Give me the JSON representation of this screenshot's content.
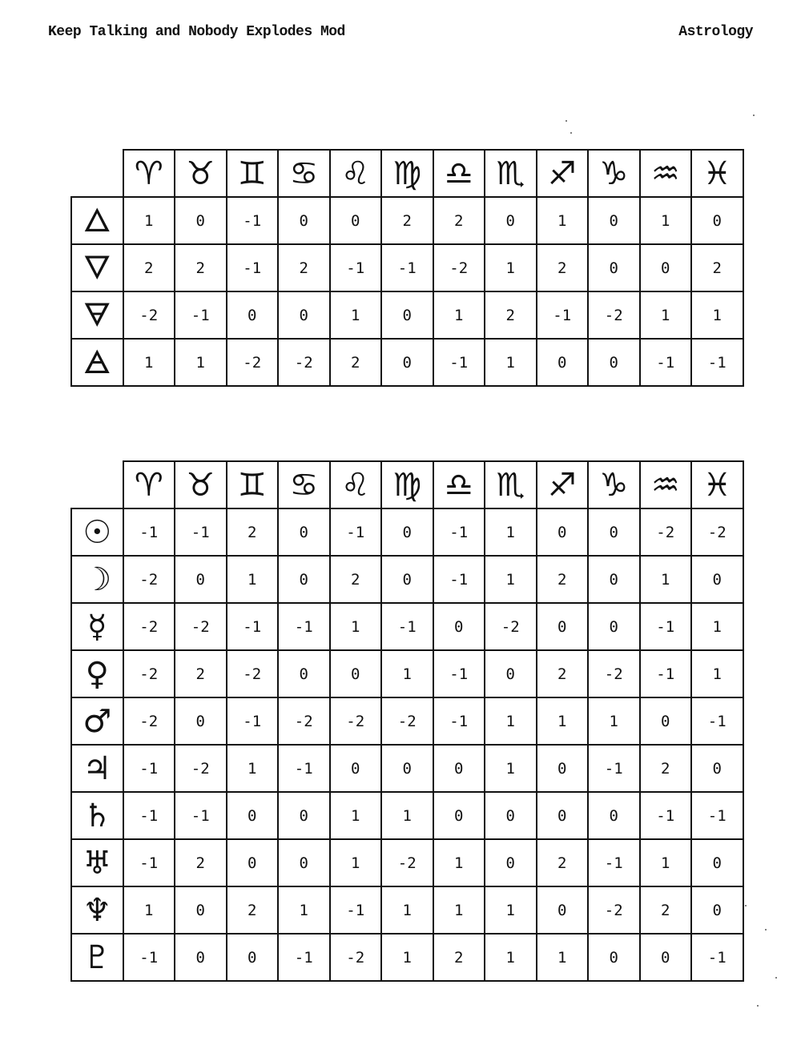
{
  "header": {
    "left": "Keep Talking and Nobody Explodes Mod",
    "right": "Astrology"
  },
  "zodiac": [
    {
      "glyph": "♈",
      "icon": "aries-icon"
    },
    {
      "glyph": "♉",
      "icon": "taurus-icon"
    },
    {
      "glyph": "♊",
      "icon": "gemini-icon"
    },
    {
      "glyph": "♋",
      "icon": "cancer-icon"
    },
    {
      "glyph": "♌",
      "icon": "leo-icon"
    },
    {
      "glyph": "♍",
      "icon": "virgo-icon"
    },
    {
      "glyph": "♎",
      "icon": "libra-icon"
    },
    {
      "glyph": "♏",
      "icon": "scorpio-icon"
    },
    {
      "glyph": "♐",
      "icon": "sagittarius-icon"
    },
    {
      "glyph": "♑",
      "icon": "capricorn-icon"
    },
    {
      "glyph": "♒",
      "icon": "aquarius-icon"
    },
    {
      "glyph": "♓",
      "icon": "pisces-icon"
    }
  ],
  "elements_table": {
    "rows": [
      {
        "glyph": "🜂",
        "icon": "fire-element-icon",
        "values": [
          "1",
          "0",
          "-1",
          "0",
          "0",
          "2",
          "2",
          "0",
          "1",
          "0",
          "1",
          "0"
        ]
      },
      {
        "glyph": "🜄",
        "icon": "water-element-icon",
        "values": [
          "2",
          "2",
          "-1",
          "2",
          "-1",
          "-1",
          "-2",
          "1",
          "2",
          "0",
          "0",
          "2"
        ]
      },
      {
        "glyph": "🜃",
        "icon": "earth-element-icon",
        "values": [
          "-2",
          "-1",
          "0",
          "0",
          "1",
          "0",
          "1",
          "2",
          "-1",
          "-2",
          "1",
          "1"
        ]
      },
      {
        "glyph": "🜁",
        "icon": "air-element-icon",
        "values": [
          "1",
          "1",
          "-2",
          "-2",
          "2",
          "0",
          "-1",
          "1",
          "0",
          "0",
          "-1",
          "-1"
        ]
      }
    ]
  },
  "planets_table": {
    "rows": [
      {
        "glyph": "☉",
        "icon": "sun-icon",
        "values": [
          "-1",
          "-1",
          "2",
          "0",
          "-1",
          "0",
          "-1",
          "1",
          "0",
          "0",
          "-2",
          "-2"
        ]
      },
      {
        "glyph": "☽",
        "icon": "moon-icon",
        "values": [
          "-2",
          "0",
          "1",
          "0",
          "2",
          "0",
          "-1",
          "1",
          "2",
          "0",
          "1",
          "0"
        ]
      },
      {
        "glyph": "☿",
        "icon": "mercury-icon",
        "values": [
          "-2",
          "-2",
          "-1",
          "-1",
          "1",
          "-1",
          "0",
          "-2",
          "0",
          "0",
          "-1",
          "1"
        ]
      },
      {
        "glyph": "♀",
        "icon": "venus-icon",
        "values": [
          "-2",
          "2",
          "-2",
          "0",
          "0",
          "1",
          "-1",
          "0",
          "2",
          "-2",
          "-1",
          "1"
        ]
      },
      {
        "glyph": "♂",
        "icon": "mars-icon",
        "values": [
          "-2",
          "0",
          "-1",
          "-2",
          "-2",
          "-2",
          "-1",
          "1",
          "1",
          "1",
          "0",
          "-1"
        ]
      },
      {
        "glyph": "♃",
        "icon": "jupiter-icon",
        "values": [
          "-1",
          "-2",
          "1",
          "-1",
          "0",
          "0",
          "0",
          "1",
          "0",
          "-1",
          "2",
          "0"
        ]
      },
      {
        "glyph": "♄",
        "icon": "saturn-icon",
        "values": [
          "-1",
          "-1",
          "0",
          "0",
          "1",
          "1",
          "0",
          "0",
          "0",
          "0",
          "-1",
          "-1"
        ]
      },
      {
        "glyph": "♅",
        "icon": "uranus-icon",
        "values": [
          "-1",
          "2",
          "0",
          "0",
          "1",
          "-2",
          "1",
          "0",
          "2",
          "-1",
          "1",
          "0"
        ]
      },
      {
        "glyph": "♆",
        "icon": "neptune-icon",
        "values": [
          "1",
          "0",
          "2",
          "1",
          "-1",
          "1",
          "1",
          "1",
          "0",
          "-2",
          "2",
          "0"
        ]
      },
      {
        "glyph": "♇",
        "icon": "pluto-icon",
        "values": [
          "-1",
          "0",
          "0",
          "-1",
          "-2",
          "1",
          "2",
          "1",
          "1",
          "0",
          "0",
          "-1"
        ]
      }
    ]
  }
}
